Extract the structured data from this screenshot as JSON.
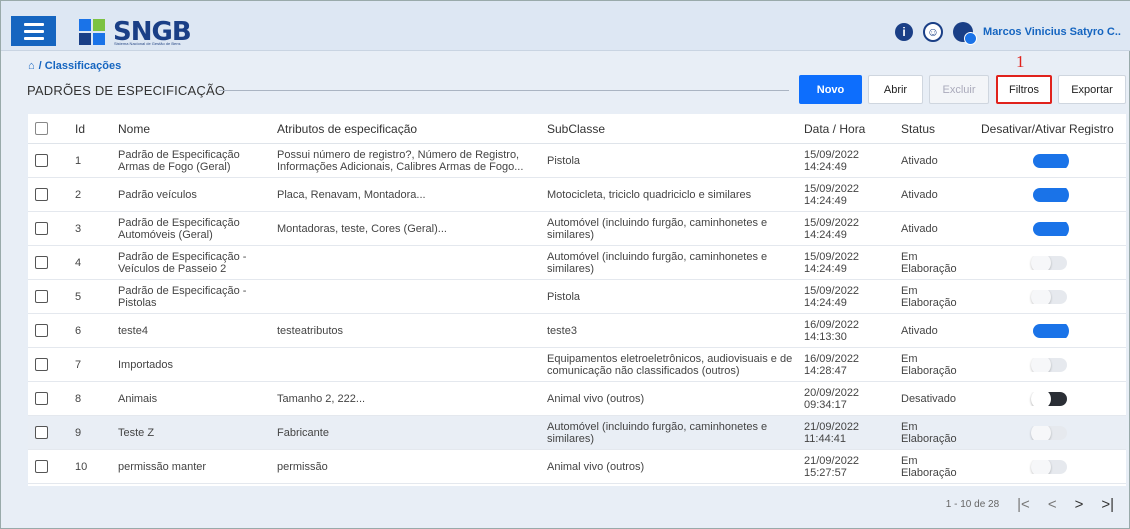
{
  "header": {
    "logo_text": "SNGB",
    "logo_subtitle": "Sistema Nacional de Gestão de Bens",
    "user_name": "Marcos Vinicius Satyro C.."
  },
  "breadcrumb": {
    "label": "/ Classificações"
  },
  "page": {
    "title": "PADRÕES DE ESPECIFICAÇÃO"
  },
  "toolbar": {
    "novo": "Novo",
    "abrir": "Abrir",
    "excluir": "Excluir",
    "filtros": "Filtros",
    "exportar": "Exportar",
    "marker": "1"
  },
  "table": {
    "headers": {
      "id": "Id",
      "nome": "Nome",
      "atributos": "Atributos de especificação",
      "subclasse": "SubClasse",
      "data": "Data / Hora",
      "status": "Status",
      "toggle": "Desativar/Ativar Registro"
    },
    "rows": [
      {
        "id": "1",
        "nome": "Padrão de Especificação Armas de Fogo (Geral)",
        "atributos": "Possui número de registro?, Número de Registro, Informações Adicionais, Calibres Armas de Fogo...",
        "subclasse": "Pistola",
        "data": "15/09/2022 14:24:49",
        "status": "Ativado",
        "toggle": "on"
      },
      {
        "id": "2",
        "nome": "Padrão veículos",
        "atributos": "Placa, Renavam, Montadora...",
        "subclasse": "Motocicleta, triciclo quadriciclo e similares",
        "data": "15/09/2022 14:24:49",
        "status": "Ativado",
        "toggle": "on"
      },
      {
        "id": "3",
        "nome": "Padrão de Especificação Automóveis (Geral)",
        "atributos": "Montadoras, teste, Cores (Geral)...",
        "subclasse": "Automóvel (incluindo furgão, caminhonetes e similares)",
        "data": "15/09/2022 14:24:49",
        "status": "Ativado",
        "toggle": "on"
      },
      {
        "id": "4",
        "nome": "Padrão de Especificação - Veículos de Passeio 2",
        "atributos": "",
        "subclasse": "Automóvel (incluindo furgão, caminhonetes e similares)",
        "data": "15/09/2022 14:24:49",
        "status": "Em Elaboração",
        "toggle": "off"
      },
      {
        "id": "5",
        "nome": "Padrão de Especificação - Pistolas",
        "atributos": "",
        "subclasse": "Pistola",
        "data": "15/09/2022 14:24:49",
        "status": "Em Elaboração",
        "toggle": "off"
      },
      {
        "id": "6",
        "nome": "teste4",
        "atributos": "testeatributos",
        "subclasse": "teste3",
        "data": "16/09/2022 14:13:30",
        "status": "Ativado",
        "toggle": "on"
      },
      {
        "id": "7",
        "nome": "Importados",
        "atributos": "",
        "subclasse": "Equipamentos eletroeletrônicos, audiovisuais e de comunicação não classificados (outros)",
        "data": "16/09/2022 14:28:47",
        "status": "Em Elaboração",
        "toggle": "off"
      },
      {
        "id": "8",
        "nome": "Animais",
        "atributos": "Tamanho 2, 222...",
        "subclasse": "Animal vivo (outros)",
        "data": "20/09/2022 09:34:17",
        "status": "Desativado",
        "toggle": "dark"
      },
      {
        "id": "9",
        "nome": "Teste Z",
        "atributos": "Fabricante",
        "subclasse": "Automóvel (incluindo furgão, caminhonetes e similares)",
        "data": "21/09/2022 11:44:41",
        "status": "Em Elaboração",
        "toggle": "off"
      },
      {
        "id": "10",
        "nome": "permissão manter",
        "atributos": "permissão",
        "subclasse": "Animal vivo (outros)",
        "data": "21/09/2022 15:27:57",
        "status": "Em Elaboração",
        "toggle": "off"
      }
    ]
  },
  "pagination": {
    "range": "1 - 10 de 28"
  },
  "colors": {
    "primary": "#0d6efd",
    "navy": "#1a3f86",
    "toggle_on": "#1a73e8",
    "highlight": "#e0221c"
  }
}
